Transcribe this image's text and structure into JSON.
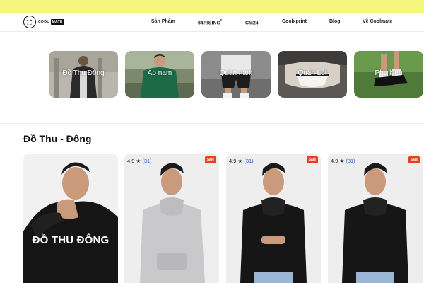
{
  "nav": {
    "logo_text": "COOL",
    "logo_badge": "MATE",
    "items": [
      {
        "label": "Sản Phẩm"
      },
      {
        "label": "84RISING",
        "sup": "*"
      },
      {
        "label": "CM24",
        "sup": "•"
      },
      {
        "label": "Coolxprint"
      },
      {
        "label": "Blog"
      },
      {
        "label": "Về Coolmate"
      }
    ]
  },
  "categories": [
    {
      "label": "Đồ Thu Đông"
    },
    {
      "label": "Áo nam"
    },
    {
      "label": "Quần nam"
    },
    {
      "label": "Quần Lót"
    },
    {
      "label": "Phụ kiện"
    }
  ],
  "section": {
    "title": "Đồ Thu - Đông",
    "banner_text": "ĐỒ THU ĐÔNG"
  },
  "products": [
    {
      "rating": "4.9 ★",
      "count": "(31)",
      "badge": "Sale",
      "color": "grey"
    },
    {
      "rating": "4.9 ★",
      "count": "(31)",
      "badge": "Sale",
      "color": "black"
    },
    {
      "rating": "4.9 ★",
      "count": "(31)",
      "badge": "Sale",
      "color": "black"
    }
  ],
  "colors": {
    "topbar": "#f5f77c",
    "sale_badge": "#e8401c",
    "rating_count": "#2e5fc9"
  }
}
